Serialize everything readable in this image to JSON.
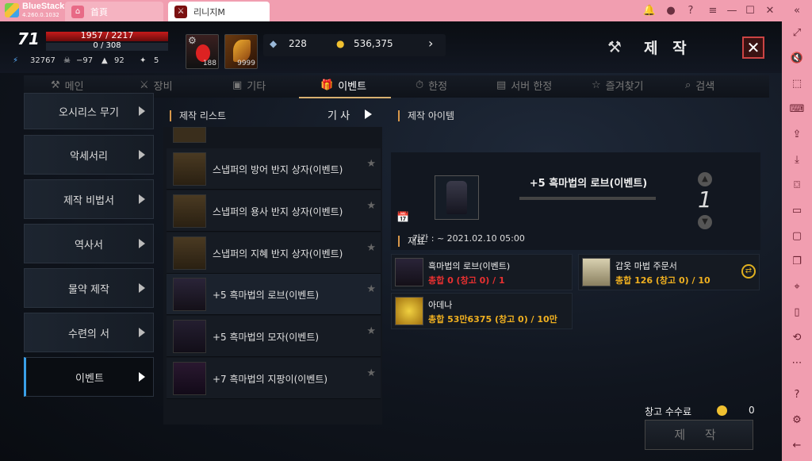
{
  "window": {
    "app_name": "BlueStacks",
    "app_version": "4.260.0.1032",
    "tabs": [
      {
        "label": "首頁"
      },
      {
        "label": "리니지M"
      }
    ]
  },
  "player": {
    "level": "71",
    "hp": "1957 / 2217",
    "mp": "0 / 308",
    "stat_1": "32767",
    "stat_2": "−97",
    "stat_3": "92",
    "stat_4": "5"
  },
  "quick_items": [
    {
      "count": "188"
    },
    {
      "count": "9999"
    }
  ],
  "currency": {
    "crystal": "228",
    "adena": "536,375"
  },
  "header": {
    "title": "제 작"
  },
  "categories": [
    {
      "label": "메인"
    },
    {
      "label": "장비"
    },
    {
      "label": "기타"
    },
    {
      "label": "이벤트"
    },
    {
      "label": "한정"
    },
    {
      "label": "서버 한정"
    },
    {
      "label": "즐겨찾기"
    },
    {
      "label": "검색"
    }
  ],
  "left_menu": [
    {
      "label": "오시리스 무기"
    },
    {
      "label": "악세서리"
    },
    {
      "label": "제작 비법서"
    },
    {
      "label": "역사서"
    },
    {
      "label": "물약 제작"
    },
    {
      "label": "수련의 서"
    },
    {
      "label": "이벤트"
    }
  ],
  "craft_list": {
    "title": "제작 리스트",
    "filter": "기 사",
    "items": [
      {
        "label": "스냅퍼의 방어 반지 상자(이벤트)"
      },
      {
        "label": "스냅퍼의 용사 반지 상자(이벤트)"
      },
      {
        "label": "스냅퍼의 지혜 반지 상자(이벤트)"
      },
      {
        "label": "+5 흑마법의 로브(이벤트)"
      },
      {
        "label": "+5 흑마법의 모자(이벤트)"
      },
      {
        "label": "+7 흑마법의 지팡이(이벤트)"
      }
    ]
  },
  "craft_item": {
    "section_title": "제작 아이템",
    "name": "+5 흑마법의 로브(이벤트)",
    "quantity": "1",
    "period": "기간 : ~ 2021.02.10 05:00"
  },
  "materials": {
    "title": "재료",
    "items": [
      {
        "name": "흑마법의 로브(이벤트)",
        "count": "총합 0 (창고 0) / 1",
        "status_color": "#e83030"
      },
      {
        "name": "갑옷 마법 주문서",
        "count": "총합 126 (창고 0) / 10",
        "status_color": "#f0b020"
      },
      {
        "name": "아데나",
        "count": "총합 53만6375 (창고 0) / 10만",
        "status_color": "#f0b020"
      }
    ]
  },
  "footer": {
    "fee_label": "창고 수수료",
    "fee_value": "0",
    "craft_button": "제 작"
  }
}
